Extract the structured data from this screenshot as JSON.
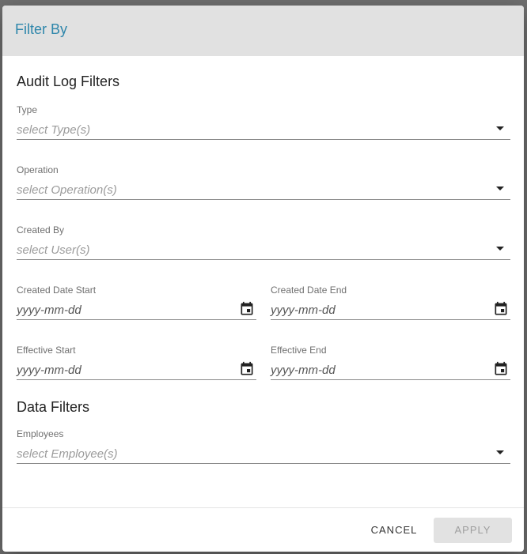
{
  "dialog": {
    "title": "Filter By"
  },
  "audit_section": {
    "title": "Audit Log Filters",
    "type": {
      "label": "Type",
      "placeholder": "select Type(s)"
    },
    "operation": {
      "label": "Operation",
      "placeholder": "select Operation(s)"
    },
    "created_by": {
      "label": "Created By",
      "placeholder": "select User(s)"
    },
    "created_date_start": {
      "label": "Created Date Start",
      "placeholder": "yyyy-mm-dd"
    },
    "created_date_end": {
      "label": "Created Date End",
      "placeholder": "yyyy-mm-dd"
    },
    "effective_start": {
      "label": "Effective Start",
      "placeholder": "yyyy-mm-dd"
    },
    "effective_end": {
      "label": "Effective End",
      "placeholder": "yyyy-mm-dd"
    }
  },
  "data_section": {
    "title": "Data Filters",
    "employees": {
      "label": "Employees",
      "placeholder": "select Employee(s)"
    }
  },
  "footer": {
    "cancel_label": "CANCEL",
    "apply_label": "APPLY"
  },
  "colors": {
    "title_accent": "#2e86ab",
    "header_bg": "#e1e1e1",
    "disabled_button_bg": "#e2e2e2"
  },
  "icons": {
    "dropdown": "caret-down-icon",
    "date": "calendar-icon"
  }
}
